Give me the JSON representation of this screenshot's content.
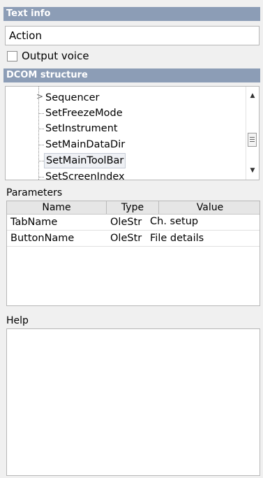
{
  "text_info": {
    "header": "Text info",
    "action_value": "Action",
    "output_voice_label": "Output voice",
    "output_voice_checked": false
  },
  "dcom": {
    "header": "DCOM structure",
    "items": [
      {
        "label": "Sequencer",
        "expandable": true
      },
      {
        "label": "SetFreezeMode"
      },
      {
        "label": "SetInstrument"
      },
      {
        "label": "SetMainDataDir"
      },
      {
        "label": "SetMainToolBar",
        "selected": true
      },
      {
        "label": "SetScreenIndex"
      }
    ]
  },
  "parameters": {
    "label": "Parameters",
    "columns": [
      "Name",
      "Type",
      "Value"
    ],
    "rows": [
      {
        "name": "TabName",
        "type": "OleStr",
        "value": "Ch. setup"
      },
      {
        "name": "ButtonName",
        "type": "OleStr",
        "value": "File details"
      }
    ]
  },
  "help": {
    "label": "Help",
    "content": ""
  },
  "colors": {
    "header_bg": "#8c9db6",
    "panel_bg": "#f0f0f0"
  }
}
